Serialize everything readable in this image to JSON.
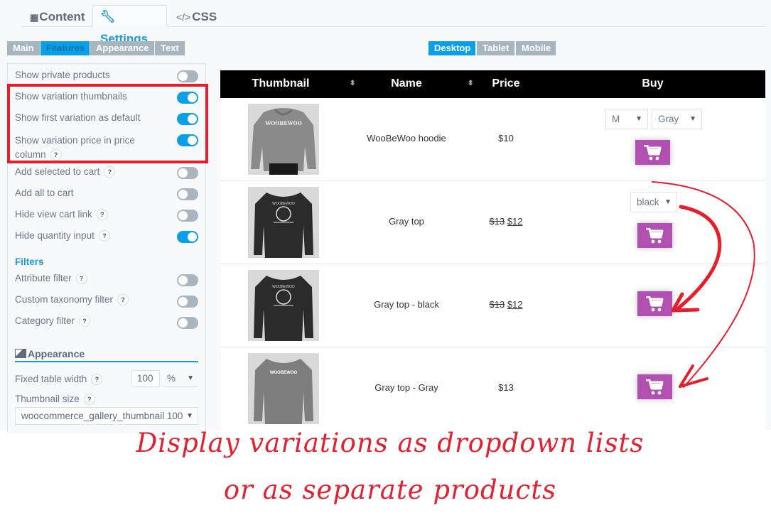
{
  "top_tabs": [
    {
      "label": "Content",
      "icon": "grid-icon",
      "active": false
    },
    {
      "label": "Settings",
      "icon": "wrench-icon",
      "active": true
    },
    {
      "label": "CSS",
      "icon": "code-icon",
      "active": false
    }
  ],
  "sub_tabs": [
    {
      "label": "Main",
      "active": false
    },
    {
      "label": "Features",
      "active": true
    },
    {
      "label": "Appearance",
      "active": false
    },
    {
      "label": "Text",
      "active": false
    }
  ],
  "device_tabs": [
    {
      "label": "Desktop",
      "active": true
    },
    {
      "label": "Tablet",
      "active": false
    },
    {
      "label": "Mobile",
      "active": false
    }
  ],
  "settings": {
    "options": [
      {
        "label": "Show private products",
        "help": false,
        "on": false
      },
      {
        "label": "Show variation thumbnails",
        "help": false,
        "on": true
      },
      {
        "label": "Show first variation as default",
        "help": false,
        "on": true
      },
      {
        "label": "Show variation price in price",
        "label2": "column",
        "help": true,
        "on": true
      },
      {
        "label": "Add selected to cart",
        "help": true,
        "on": false
      },
      {
        "label": "Add all to cart",
        "help": false,
        "on": false
      },
      {
        "label": "Hide view cart link",
        "help": true,
        "on": false
      },
      {
        "label": "Hide quantity input",
        "help": true,
        "on": true
      }
    ],
    "filters_title": "Filters",
    "filters": [
      {
        "label": "Attribute filter",
        "help": true,
        "on": false
      },
      {
        "label": "Custom taxonomy filter",
        "help": true,
        "on": false
      },
      {
        "label": "Category filter",
        "help": true,
        "on": false
      }
    ],
    "appearance_title": "Appearance",
    "fixed_table_width_label": "Fixed table width",
    "fixed_table_width_value": "100",
    "fixed_table_width_unit": "%",
    "thumbnail_size_label": "Thumbnail size",
    "thumbnail_size_value": "woocommerce_gallery_thumbnail 100 :",
    "help_glyph": "?",
    "dropdown_glyph": "▼"
  },
  "table": {
    "headers": {
      "thumbnail": "Thumbnail",
      "name": "Name",
      "price": "Price",
      "buy": "Buy"
    },
    "sort_glyph": "⬍",
    "rows": [
      {
        "name": "WooBeWoo hoodie",
        "price": "$10",
        "old_price": "",
        "selects": [
          "M",
          "Gray"
        ],
        "image": "gray hoodie",
        "color": "#8a8a8a"
      },
      {
        "name": "Gray top",
        "price": "$12",
        "old_price": "$13",
        "selects": [
          "black"
        ],
        "image": "black top",
        "color": "#2b2b2b"
      },
      {
        "name": "Gray top - black",
        "price": "$12",
        "old_price": "$13",
        "selects": [],
        "image": "black top",
        "color": "#2b2b2b"
      },
      {
        "name": "Gray top - Gray",
        "price": "$13",
        "old_price": "",
        "selects": [],
        "image": "gray top",
        "color": "#7d7d7d"
      }
    ]
  },
  "annotation": {
    "line1": "Display variations as dropdown lists",
    "line2": "or as separate products",
    "color": "#e02230"
  },
  "colors": {
    "accent": "#0aa0e8",
    "cart": "#b150b1",
    "highlight": "#e61e2b"
  }
}
